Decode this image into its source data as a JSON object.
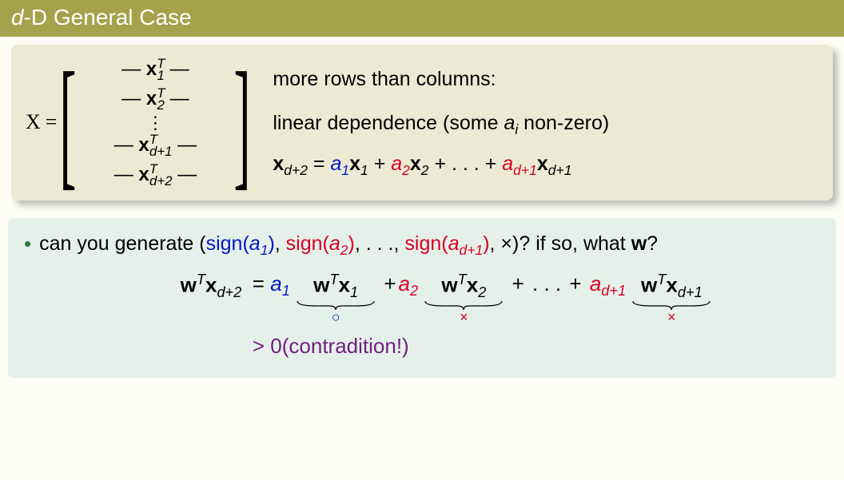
{
  "title_prefix": "d",
  "title_rest": "-D General Case",
  "matrix": {
    "X_label": "X",
    "equals": "=",
    "dash": "—",
    "vdots": "⋮",
    "x_sym": "x",
    "T": "T",
    "sub1": "1",
    "sub2": "2",
    "sub_dp1": "d+1",
    "sub_dp2": "d+2"
  },
  "topright": {
    "line1": "more rows than columns:",
    "line2_pre": "linear dependence (some ",
    "line2_ai_a": "a",
    "line2_ai_i": "i",
    "line2_post": " non-zero)",
    "eq_lhs_x": "x",
    "eq_lhs_sub": "d+2",
    "equals": " = ",
    "a": "a",
    "x": "x",
    "plus": " + ",
    "dots": ". . .",
    "sub1": "1",
    "sub2": "2",
    "sub_dp1": "d+1"
  },
  "bullet": {
    "pre": "can you generate (",
    "sign": "sign",
    "a": "a",
    "sub1": "1",
    "sub2": "2",
    "sub_dp1": "d+1",
    "comma": ", ",
    "dots": ". . .",
    "times": "×",
    "post": ")? if so, what ",
    "w": "w",
    "q": "?"
  },
  "eq": {
    "w": "w",
    "T": "T",
    "x": "x",
    "sub_dp2": "d+2",
    "equals": "=",
    "a": "a",
    "sub1": "1",
    "sub2": "2",
    "sub_dp1": "d+1",
    "plus": "+",
    "dots": ". . .",
    "circle": "○",
    "times": "×",
    "gt": ">",
    "zero_contra": "0(contradition!)"
  }
}
